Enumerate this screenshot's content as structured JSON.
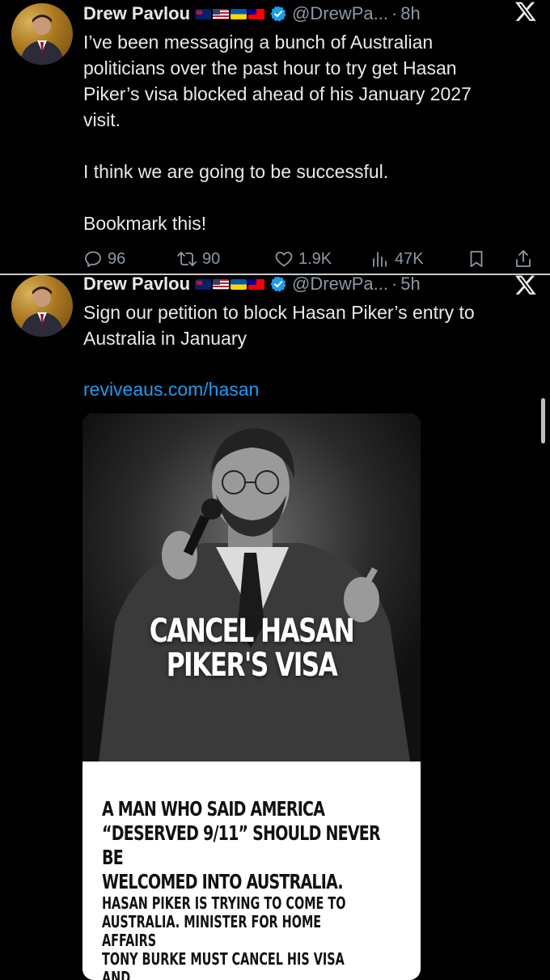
{
  "tweets": [
    {
      "display_name": "Drew Pavlou",
      "handle": "@DrewPa...",
      "separator": "·",
      "time": "8h",
      "text": "I’ve been messaging a bunch of Australian\npoliticians over the past hour to try get Hasan\nPiker’s visa blocked ahead of his January 2027\nvisit.\n\nI think we are going to be successful.\n\nBookmark this!",
      "replies": "96",
      "retweets": "90",
      "likes": "1.9K",
      "views": "47K"
    },
    {
      "display_name": "Drew Pavlou",
      "handle": "@DrewPa...",
      "separator": "·",
      "time": "5h",
      "text": "Sign our petition to block Hasan Piker’s entry to\nAustralia in January",
      "link": "reviveaus.com/hasan",
      "card": {
        "photo_headline_line1": "CANCEL HASAN",
        "photo_headline_line2": "PIKER'S VISA",
        "headline": "A MAN WHO SAID AMERICA\n“DESERVED 9/11” SHOULD NEVER BE\nWELCOMED INTO AUSTRALIA.",
        "paragraph": "HASAN PIKER IS TRYING TO COME TO\nAUSTRALIA. MINISTER FOR HOME AFFAIRS\nTONY BURKE MUST CANCEL HIS VISA AND\nREFUSE HIM ENTRY."
      }
    }
  ],
  "icons": {
    "verified": "verified-badge-icon",
    "x_logo": "x-logo-icon",
    "reply": "reply-icon",
    "retweet": "retweet-icon",
    "like": "heart-icon",
    "views": "views-icon",
    "bookmark": "bookmark-icon",
    "share": "share-icon"
  },
  "colors": {
    "background": "#000000",
    "text": "#e7e9ea",
    "secondary": "#8b98a5",
    "link": "#1d9bf0",
    "verified": "#1d9bf0"
  }
}
